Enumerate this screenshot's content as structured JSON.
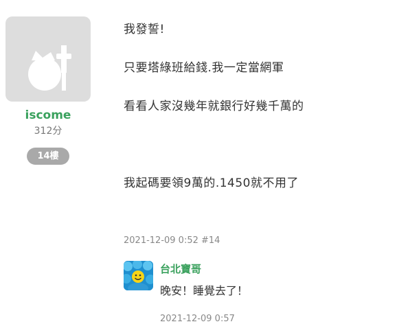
{
  "author": {
    "avatar_icon": "default-avatar-icon",
    "name": "iscome",
    "score": "312分",
    "floor": "14樓"
  },
  "body": {
    "lines": [
      "我發誓!",
      "只要塔綠班給錢.我一定當網軍",
      "看看人家沒幾年就銀行好幾千萬的",
      "我起碼要領9萬的.1450就不用了"
    ]
  },
  "meta": {
    "timestamp": "2021-12-09 0:52 #14"
  },
  "comment": {
    "avatar_icon": "smiley-crowd-avatar",
    "user": "台北寶哥",
    "text": "晚安！睡覺去了！",
    "timestamp": "2021-12-09 0:57"
  },
  "colors": {
    "username": "#3aa15d",
    "badge": "#a9a9a9",
    "avatar_bg": "#dddddd"
  }
}
